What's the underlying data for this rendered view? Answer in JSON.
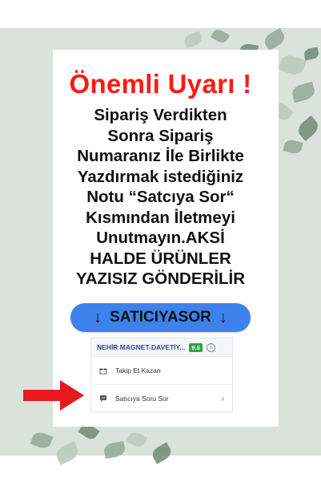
{
  "warning_title": "Önemli Uyarı !",
  "message_lines": [
    "Sipariş Verdikten",
    "Sonra Sipariş",
    "Numaranız İle Birlikte",
    "Yazdırmak istediğiniz",
    "Notu “Satcıya Sor“",
    "Kısmından İletmeyi",
    "Unutmayın.AKSİ",
    "HALDE ÜRÜNLER",
    "YAZISIZ GÖNDERİLİR"
  ],
  "cta": {
    "label": "SATICIYASOR",
    "left_arrow": "↓",
    "right_arrow": "↓"
  },
  "panel": {
    "shop_name": "NEHİR MAGNET-DAVETİY...",
    "rating": "9.5",
    "info_icon": "i",
    "rows": [
      {
        "label": "Takip Et Kazan",
        "icon": "gift-icon"
      },
      {
        "label": "Satıcıya Soru Sor",
        "icon": "chat-icon",
        "chevron": "›"
      }
    ]
  },
  "colors": {
    "title_red": "#ff1a14",
    "cta_blue": "#3d82ec",
    "rating_green": "#28a745",
    "background_sage": "#d9e3dc",
    "arrow_red": "#e8191d"
  }
}
